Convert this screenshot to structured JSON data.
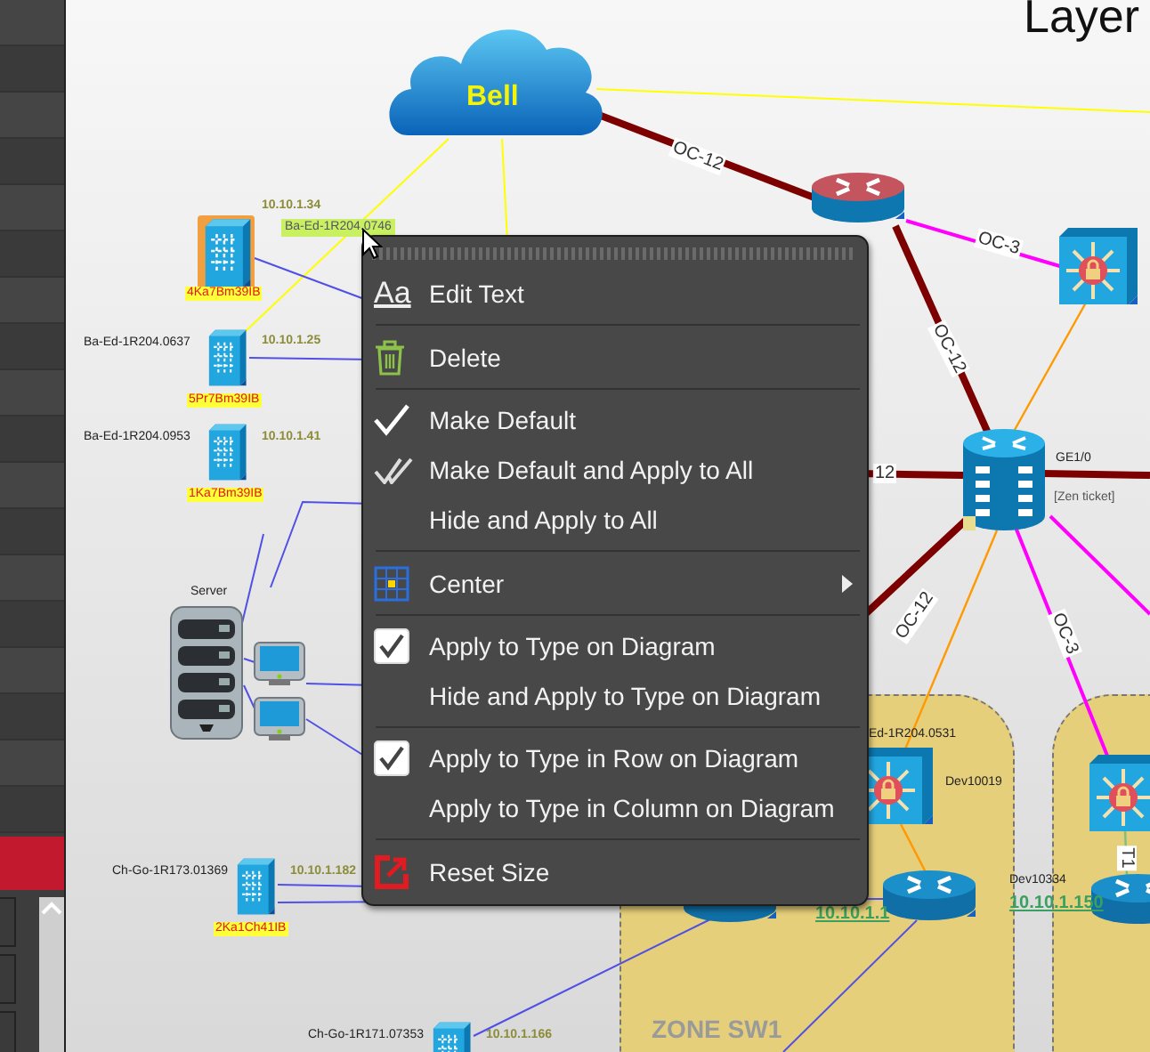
{
  "diagram": {
    "title": "Layer",
    "zones": [
      {
        "kind": "zone",
        "label": "ZONE SW1"
      },
      {
        "kind": "zone"
      }
    ],
    "nodes": [
      {
        "kind": "cloud",
        "label": "Bell"
      },
      {
        "kind": "switch",
        "host": "Ba-Ed-1R204.0746",
        "ip": "10.10.1.34",
        "name": "4Ka7Bm39IB",
        "selected": true
      },
      {
        "kind": "switch",
        "host": "Ba-Ed-1R204.0637",
        "ip": "10.10.1.25",
        "name": "5Pr7Bm39IB",
        "selected": false
      },
      {
        "kind": "switch",
        "host": "Ba-Ed-1R204.0953",
        "ip": "10.10.1.41",
        "name": "1Ka7Bm39IB",
        "selected": false
      },
      {
        "kind": "server",
        "label": "Server"
      },
      {
        "kind": "monitor"
      },
      {
        "kind": "monitor"
      },
      {
        "kind": "switch",
        "host": "Ch-Go-1R173.01369",
        "ip": "10.10.1.182",
        "name": "2Ka1Ch41IB",
        "selected": false
      },
      {
        "kind": "switch",
        "host": "Ch-Go-1R171.07353",
        "ip": "10.10.1.166",
        "selected": false
      },
      {
        "kind": "router",
        "color": "#c4545e"
      },
      {
        "kind": "l3switch"
      },
      {
        "kind": "core",
        "label": "GE1/0",
        "note": "[Zen ticket]"
      },
      {
        "kind": "l3switch",
        "host": "Ed-1R204.0531",
        "label": "Dev10019"
      },
      {
        "kind": "router",
        "color": "#1b8fc9",
        "ip": "10.10.1.1"
      },
      {
        "kind": "router"
      },
      {
        "kind": "l3switch"
      },
      {
        "kind": "router",
        "color": "#1b8fc9",
        "label": "Dev10334",
        "ip": "10.10.1.150"
      }
    ],
    "links": [
      {
        "color": "#7d0000",
        "label": "OC-12"
      },
      {
        "color": "#ff00ff",
        "label": "OC-3"
      },
      {
        "color": "#7d0000",
        "label": "OC-12"
      },
      {
        "color": "#7d0000",
        "label": "12"
      },
      {
        "color": "#7d0000"
      },
      {
        "color": "#7d0000",
        "label": "OC-12"
      },
      {
        "color": "#ff00ff",
        "label": "OC-3"
      },
      {
        "color": "#ff00ff"
      },
      {
        "color": "#ff9900"
      },
      {
        "color": "#ff9900"
      },
      {
        "color": "#ff9900"
      },
      {
        "color": "#7dbf7d",
        "label": "T1"
      },
      {
        "color": "#ffff00"
      },
      {
        "color": "#ffff00"
      },
      {
        "color": "#ffff00"
      },
      {
        "color": "#5050e6"
      },
      {
        "color": "#5050e6"
      },
      {
        "color": "#5050e6"
      },
      {
        "color": "#5050e6"
      },
      {
        "color": "#5050e6"
      },
      {
        "color": "#5050e6"
      },
      {
        "color": "#5050e6"
      },
      {
        "color": "#5050e6"
      },
      {
        "color": "#5050e6"
      },
      {
        "color": "#5050e6"
      },
      {
        "color": "#5050e6"
      },
      {
        "color": "#5050e6"
      }
    ]
  },
  "context_menu": {
    "groups": [
      [
        {
          "kind": "icon",
          "glyph": "Aa",
          "label": "Edit Text"
        }
      ],
      [
        {
          "kind": "icon",
          "label": "Delete"
        }
      ],
      [
        {
          "kind": "icon",
          "label": "Make Default"
        },
        {
          "kind": "icon",
          "label": "Make Default and Apply to All"
        },
        {
          "kind": "plain",
          "label": "Hide and Apply to All"
        }
      ],
      [
        {
          "kind": "icon",
          "label": "Center",
          "submenu": true
        }
      ],
      [
        {
          "kind": "checkbox",
          "checked": true,
          "label": "Apply to Type on Diagram"
        },
        {
          "kind": "plain",
          "label": "Hide and Apply to Type on Diagram"
        }
      ],
      [
        {
          "kind": "checkbox",
          "checked": true,
          "label": "Apply to Type in Row on Diagram"
        },
        {
          "kind": "plain",
          "label": "Apply to Type in Column on Diagram"
        }
      ],
      [
        {
          "kind": "icon",
          "label": "Reset Size"
        }
      ]
    ]
  }
}
